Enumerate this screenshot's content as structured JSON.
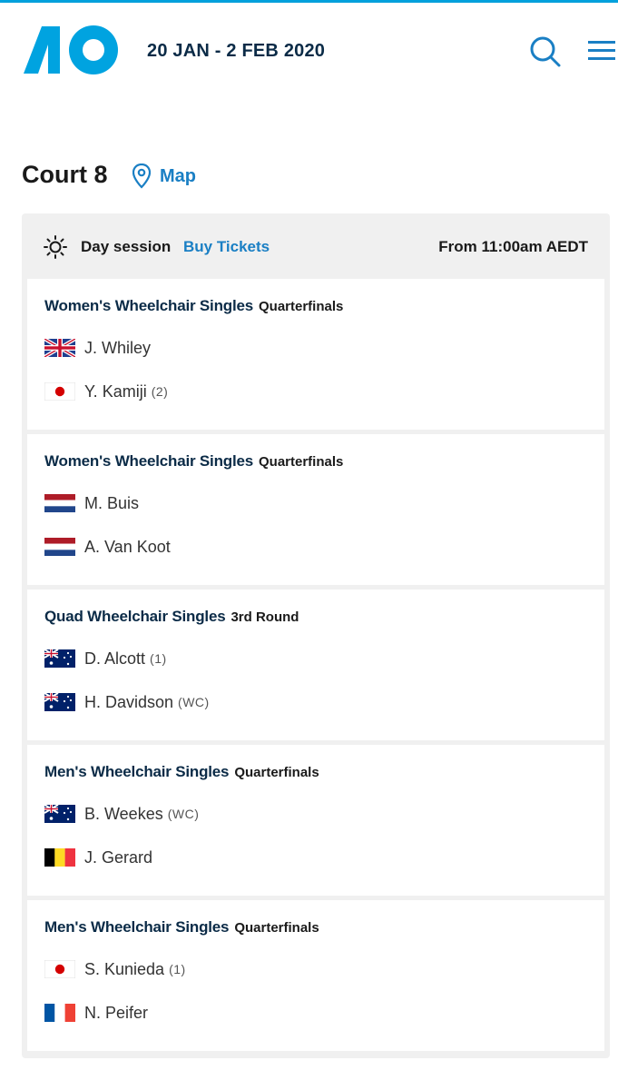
{
  "header": {
    "dates": "20 JAN - 2 FEB 2020",
    "logo_icon": "ao-logo",
    "search_icon": "search-icon",
    "menu_icon": "hamburger-menu-icon"
  },
  "court": {
    "title": "Court 8",
    "map_label": "Map"
  },
  "session": {
    "label": "Day session",
    "buy_label": "Buy Tickets",
    "time": "From 11:00am AEDT"
  },
  "matches": [
    {
      "event": "Women's Wheelchair Singles",
      "round": "Quarterfinals",
      "players": [
        {
          "name": "J. Whiley",
          "seed": "",
          "flag": "GBR"
        },
        {
          "name": "Y. Kamiji",
          "seed": "(2)",
          "flag": "JPN"
        }
      ]
    },
    {
      "event": "Women's Wheelchair Singles",
      "round": "Quarterfinals",
      "players": [
        {
          "name": "M. Buis",
          "seed": "",
          "flag": "NED"
        },
        {
          "name": "A. Van Koot",
          "seed": "",
          "flag": "NED"
        }
      ]
    },
    {
      "event": "Quad Wheelchair Singles",
      "round": "3rd Round",
      "players": [
        {
          "name": "D. Alcott",
          "seed": "(1)",
          "flag": "AUS"
        },
        {
          "name": "H. Davidson",
          "seed": "(WC)",
          "flag": "AUS"
        }
      ]
    },
    {
      "event": "Men's Wheelchair Singles",
      "round": "Quarterfinals",
      "players": [
        {
          "name": "B. Weekes",
          "seed": "(WC)",
          "flag": "AUS"
        },
        {
          "name": "J. Gerard",
          "seed": "",
          "flag": "BEL"
        }
      ]
    },
    {
      "event": "Men's Wheelchair Singles",
      "round": "Quarterfinals",
      "players": [
        {
          "name": "S. Kunieda",
          "seed": "(1)",
          "flag": "JPN"
        },
        {
          "name": "N. Peifer",
          "seed": "",
          "flag": "FRA"
        }
      ]
    }
  ],
  "colors": {
    "accent": "#00a3e0",
    "link": "#1a7fc4",
    "navy": "#0b2b47"
  }
}
